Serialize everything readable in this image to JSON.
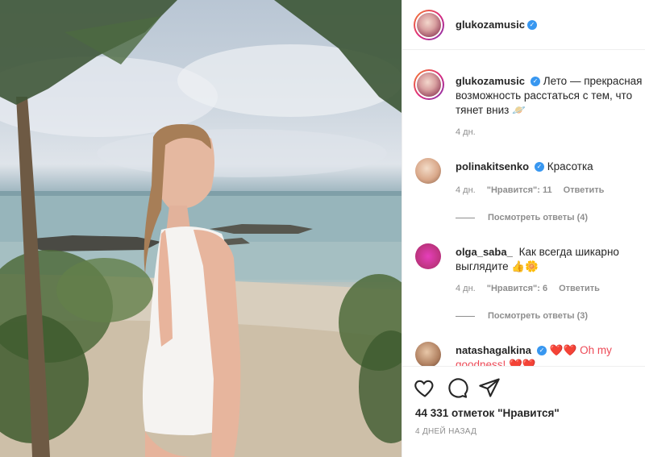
{
  "post": {
    "author": "glukozamusic",
    "photo_alt": "photo"
  },
  "caption": {
    "username": "glukozamusic",
    "text": "Лето — прекрасная возможность расстаться с тем, что тянет вниз",
    "emoji": "🪐",
    "time": "4 дн."
  },
  "comments": [
    {
      "username": "polinakitsenko",
      "verified": true,
      "text": "Красотка",
      "time": "4 дн.",
      "likes": "\"Нравится\": 11",
      "reply": "Ответить",
      "view_replies": "Посмотреть ответы (4)",
      "avatar_color": "#d9a88a"
    },
    {
      "username": "olga_saba_",
      "verified": false,
      "text": "Как всегда шикарно выглядите 👍🌼",
      "time": "4 дн.",
      "likes": "\"Нравится\": 6",
      "reply": "Ответить",
      "view_replies": "Посмотреть ответы (3)",
      "avatar_color": "#c13584"
    },
    {
      "username": "natashagalkina",
      "verified": true,
      "text": "❤️❤️ Oh my goodness! ❤️❤️",
      "avatar_color": "#b08060"
    }
  ],
  "footer": {
    "likes": "44 331 отметок \"Нравится\"",
    "date": "4 ДНЕЙ НАЗАД"
  },
  "icons": [
    "heart-icon",
    "comment-icon",
    "share-icon",
    "verified-badge-icon"
  ],
  "colors": {
    "verified": "#3897f0",
    "muted": "#8e8e8e",
    "text": "#262626"
  }
}
